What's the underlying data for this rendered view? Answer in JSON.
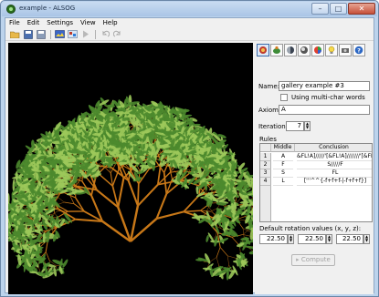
{
  "window": {
    "title": "example - ALSOG"
  },
  "menu": [
    "File",
    "Edit",
    "Settings",
    "View",
    "Help"
  ],
  "toolbar": {
    "buttons": [
      "open-icon",
      "save-icon",
      "save-as-icon",
      "render-icon",
      "settings-icon",
      "run-icon",
      "undo-icon",
      "redo-icon"
    ]
  },
  "panel": {
    "icons": [
      "lsystem-icon",
      "turtle-icon",
      "material-icon",
      "lighting-icon",
      "colors-icon",
      "light-bulb-icon",
      "camera-icon",
      "help-icon"
    ],
    "name_label": "Name:",
    "name_value": "gallery example #3",
    "multichar_label": "Using multi-char words",
    "axiom_label": "Axiom:",
    "axiom_value": "A",
    "iterations_label": "Iterations:",
    "iterations_value": "7",
    "rules_label": "Rules",
    "rules_headers": [
      "Middle",
      "Conclusion"
    ],
    "rules": [
      {
        "num": "1",
        "middle": "A",
        "conclusion": "&FL!A]/////'[&FL!A]///////'[&FL!"
      },
      {
        "num": "2",
        "middle": "F",
        "conclusion": "S/////F"
      },
      {
        "num": "3",
        "middle": "S",
        "conclusion": "FL"
      },
      {
        "num": "4",
        "middle": "L",
        "conclusion": "['''^^{-f+f+f-|-f+f+f}]"
      }
    ],
    "rotation_label": "Default rotation values (x, y, z):",
    "rotation_values": [
      "22.50",
      "22.50",
      "22.50"
    ],
    "compute_label": "Compute"
  },
  "colors": {
    "canvas": "#000000",
    "branch": "#c87818",
    "leaf": "#4c8a2e",
    "leaf_light": "#9cc85a"
  }
}
